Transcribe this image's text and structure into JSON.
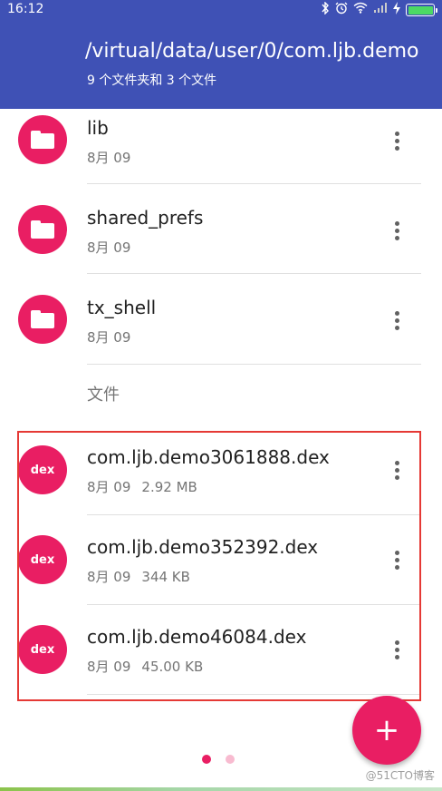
{
  "status_bar": {
    "time": "16:12",
    "icons": [
      "bluetooth-icon",
      "alarm-icon",
      "wifi-icon",
      "signal-icon",
      "charging-icon",
      "battery-icon"
    ]
  },
  "toolbar": {
    "path": "/virtual/data/user/0/com.ljb.demo",
    "summary": "9 个文件夹和 3 个文件",
    "color": "#3f51b5"
  },
  "folders": [
    {
      "name": "lib",
      "date": "8月 09"
    },
    {
      "name": "shared_prefs",
      "date": "8月 09"
    },
    {
      "name": "tx_shell",
      "date": "8月 09"
    }
  ],
  "files_header": "文件",
  "files": [
    {
      "ext": "dex",
      "name": "com.ljb.demo3061888.dex",
      "date": "8月 09",
      "size": "2.92 MB"
    },
    {
      "ext": "dex",
      "name": "com.ljb.demo352392.dex",
      "date": "8月 09",
      "size": "344 KB"
    },
    {
      "ext": "dex",
      "name": "com.ljb.demo46084.dex",
      "date": "8月 09",
      "size": "45.00 KB"
    }
  ],
  "fab": {
    "icon": "plus-icon",
    "label": "+"
  },
  "pager": {
    "pages": 2,
    "current": 1
  },
  "watermark": "@51CTO博客",
  "colors": {
    "accent": "#e91e63",
    "highlight": "#e53935"
  }
}
